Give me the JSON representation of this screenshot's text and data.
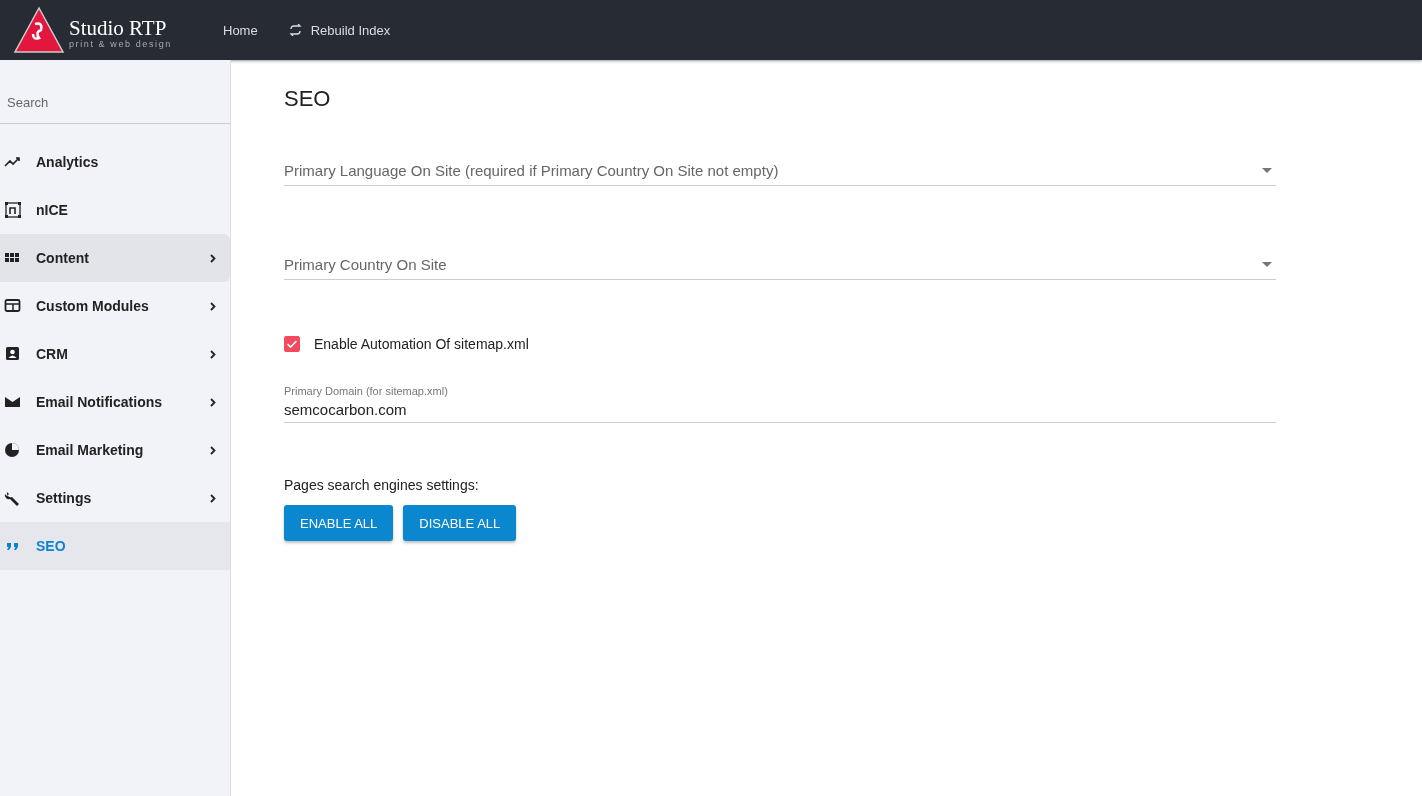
{
  "header": {
    "logo": {
      "name": "Studio RTP",
      "tagline": "print & web design"
    },
    "nav": [
      {
        "label": "Home",
        "icon": false
      },
      {
        "label": "Rebuild Index",
        "icon": true
      }
    ]
  },
  "sidebar": {
    "search": {
      "placeholder": "Search"
    },
    "items": [
      {
        "label": "Analytics",
        "expandable": false,
        "hovered": false,
        "selected": false
      },
      {
        "label": "nICE",
        "expandable": false,
        "hovered": false,
        "selected": false
      },
      {
        "label": "Content",
        "expandable": true,
        "hovered": true,
        "selected": false
      },
      {
        "label": "Custom Modules",
        "expandable": true,
        "hovered": false,
        "selected": false
      },
      {
        "label": "CRM",
        "expandable": true,
        "hovered": false,
        "selected": false
      },
      {
        "label": "Email Notifications",
        "expandable": true,
        "hovered": false,
        "selected": false
      },
      {
        "label": "Email Marketing",
        "expandable": true,
        "hovered": false,
        "selected": false
      },
      {
        "label": "Settings",
        "expandable": true,
        "hovered": false,
        "selected": false
      },
      {
        "label": "SEO",
        "expandable": false,
        "hovered": false,
        "selected": true
      }
    ]
  },
  "main": {
    "title": "SEO",
    "selects": [
      {
        "placeholder": "Primary Language On Site (required if Primary Country On Site not empty)"
      },
      {
        "placeholder": "Primary Country On Site"
      }
    ],
    "checkbox": {
      "label": "Enable Automation Of sitemap.xml",
      "checked": true
    },
    "domain": {
      "label": "Primary Domain (for sitemap.xml)",
      "value": "semcocarbon.com"
    },
    "pages_label": "Pages search engines settings:",
    "buttons": [
      "ENABLE ALL",
      "DISABLE ALL"
    ]
  }
}
